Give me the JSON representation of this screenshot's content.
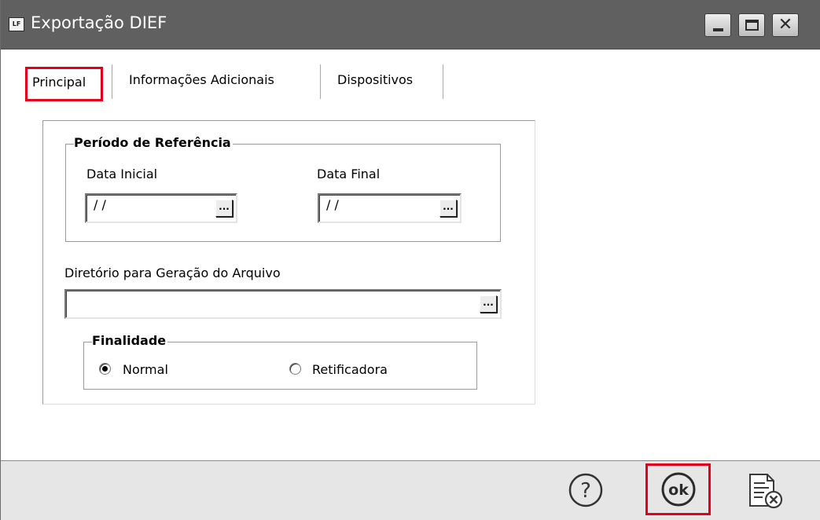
{
  "window": {
    "logo_text": "LF",
    "title": "Exportação DIEF"
  },
  "tabs": [
    {
      "label": "Principal",
      "active": true
    },
    {
      "label": "Informações Adicionais",
      "active": false
    },
    {
      "label": "Dispositivos",
      "active": false
    }
  ],
  "periodo": {
    "legend": "Período de Referência",
    "data_inicial_label": "Data Inicial",
    "data_inicial_value": "/ /",
    "data_final_label": "Data Final",
    "data_final_value": "/ /",
    "picker_label": "..."
  },
  "diretorio": {
    "label": "Diretório para Geração do Arquivo",
    "value": "",
    "picker_label": "..."
  },
  "finalidade": {
    "legend": "Finalidade",
    "options": [
      {
        "label": "Normal",
        "selected": true
      },
      {
        "label": "Retificadora",
        "selected": false
      }
    ]
  },
  "footer": {
    "help_icon": "help-icon",
    "ok_label": "ok",
    "cancel_icon": "cancel-document-icon"
  },
  "colors": {
    "titlebar": "#606060",
    "highlight": "#e3001b",
    "footer": "#e6e6e6"
  }
}
